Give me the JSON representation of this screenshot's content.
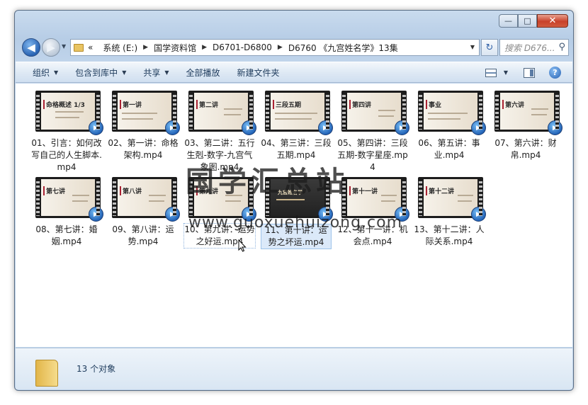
{
  "window": {
    "minimize_glyph": "—",
    "maximize_glyph": "□",
    "close_glyph": "✕"
  },
  "nav": {
    "back_glyph": "◀",
    "forward_glyph": "▶",
    "dropdown_glyph": "▼",
    "refresh_glyph": "↻",
    "search_placeholder": "搜索 D676...",
    "search_glyph": "⚲"
  },
  "breadcrumb": {
    "overflow": "«",
    "separator": "▶",
    "items": [
      "系统 (E:)",
      "国学资料馆",
      "D6701-D6800",
      "D6760 《九宫姓名学》13集"
    ]
  },
  "toolbar": {
    "organize": "组织",
    "include_in_library": "包含到库中",
    "share": "共享",
    "play_all": "全部播放",
    "new_folder": "新建文件夹",
    "caret": "▼",
    "help": "?"
  },
  "files": [
    {
      "name": "01、引言：如何改写自己的人生脚本.mp4",
      "thumb": "命格概述 1/3"
    },
    {
      "name": "02、第一讲：命格架构.mp4",
      "thumb": "第一讲"
    },
    {
      "name": "03、第二讲：五行生剋-数字-九宫气象图.mp4",
      "thumb": "第二讲"
    },
    {
      "name": "04、第三讲：三段五期.mp4",
      "thumb": "三段五期"
    },
    {
      "name": "05、第四讲：三段五期-数字星座.mp4",
      "thumb": "第四讲"
    },
    {
      "name": "06、第五讲：事业.mp4",
      "thumb": "事业"
    },
    {
      "name": "07、第六讲：财帛.mp4",
      "thumb": "第六讲"
    },
    {
      "name": "08、第七讲：婚姻.mp4",
      "thumb": "第七讲"
    },
    {
      "name": "09、第八讲：运势.mp4",
      "thumb": "第八讲"
    },
    {
      "name": "10、第九讲：运势之好运.mp4",
      "thumb": "第九讲"
    },
    {
      "name": "11、第十讲：运势之坏运.mp4",
      "thumb": "九宫姓名学"
    },
    {
      "name": "12、第十一讲：机会点.mp4",
      "thumb": "第十一讲"
    },
    {
      "name": "13、第十二讲：人际关系.mp4",
      "thumb": "第十二讲"
    }
  ],
  "play_glyph": "▶",
  "watermark": {
    "text": "国学汇总站",
    "url": "www.guoxuehuizong.com"
  },
  "details": {
    "count_text": "13 个对象"
  }
}
